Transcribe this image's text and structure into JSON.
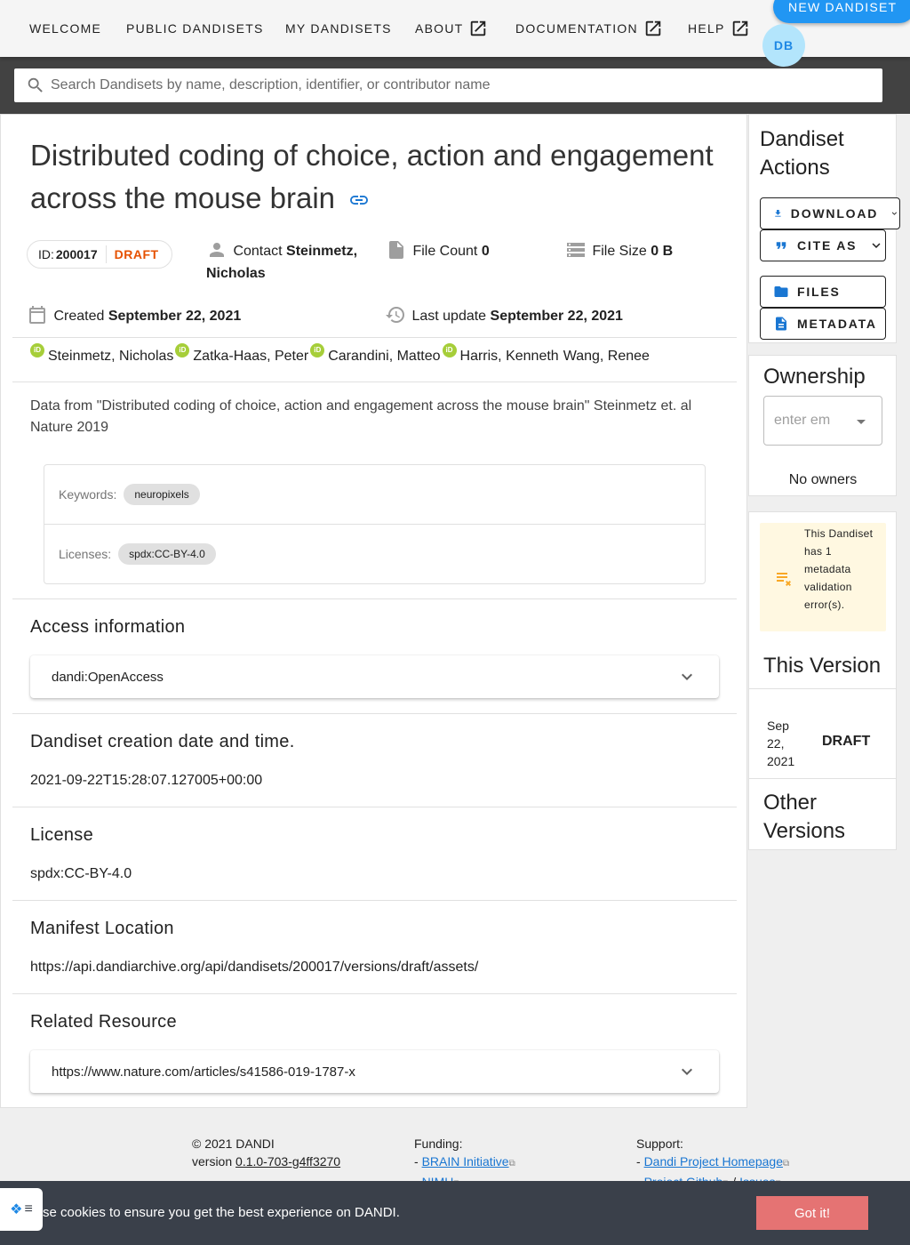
{
  "nav": {
    "welcome": "WELCOME",
    "public_dandisets": "PUBLIC DANDISETS",
    "my_dandisets": "MY DANDISETS",
    "about": "ABOUT",
    "documentation": "DOCUMENTATION",
    "help": "HELP",
    "new_dandiset": "NEW DANDISET",
    "avatar_initials": "DB"
  },
  "search": {
    "placeholder": "Search Dandisets by name, description, identifier, or contributor name"
  },
  "dandiset": {
    "title": "Distributed coding of choice, action and engagement across the mouse brain",
    "id_label": "ID:",
    "id": "200017",
    "status": "DRAFT",
    "contact_label": "Contact",
    "contact_name": "Steinmetz, Nicholas",
    "file_count_label": "File Count",
    "file_count": "0",
    "file_size_label": "File Size",
    "file_size": "0 B",
    "created_label": "Created",
    "created": "September 22, 2021",
    "updated_label": "Last update",
    "updated": "September 22, 2021",
    "contributors": [
      {
        "name": "Steinmetz, Nicholas",
        "orcid": true
      },
      {
        "name": "Zatka-Haas, Peter",
        "orcid": true
      },
      {
        "name": "Carandini, Matteo",
        "orcid": true
      },
      {
        "name": "Harris, Kenneth",
        "orcid": true
      },
      {
        "name": "Wang, Renee",
        "orcid": false
      }
    ],
    "description": "Data from \"Distributed coding of choice, action and engagement across the mouse brain\" Steinmetz et. al Nature 2019",
    "keywords_label": "Keywords:",
    "keywords": [
      "neuropixels"
    ],
    "licenses_label": "Licenses:",
    "licenses": [
      "spdx:CC-BY-4.0"
    ]
  },
  "sections": {
    "access_title": "Access information",
    "access_value": "dandi:OpenAccess",
    "creation_title": "Dandiset creation date and time.",
    "creation_value": "2021-09-22T15:28:07.127005+00:00",
    "license_title": "License",
    "license_value": "spdx:CC-BY-4.0",
    "manifest_title": "Manifest Location",
    "manifest_value": "https://api.dandiarchive.org/api/dandisets/200017/versions/draft/assets/",
    "related_title": "Related Resource",
    "related_value": "https://www.nature.com/articles/s41586-019-1787-x"
  },
  "actions": {
    "title_line1": "Dandiset",
    "title_line2": "Actions",
    "download": "DOWNLOAD",
    "cite_as": "CITE AS",
    "files": "FILES",
    "metadata": "METADATA"
  },
  "ownership": {
    "title": "Ownership",
    "select_placeholder": "enter em",
    "no_owners": "No owners"
  },
  "versions": {
    "warning": "This Dandiset has 1 metadata validation error(s).",
    "this_version_title": "This Version",
    "version_date": "Sep 22, 2021",
    "version_name": "DRAFT",
    "other_title_line1": "Other",
    "other_title_line2": "Versions"
  },
  "footer": {
    "copyright": "© 2021 DANDI",
    "version_label": "version",
    "version": "0.1.0-703-g4ff3270",
    "funding_label": "Funding:",
    "funding": [
      "BRAIN Initiative",
      "NIMH"
    ],
    "support_label": "Support:",
    "support_homepage": "Dandi Project Homepage",
    "support_github": "Project Github",
    "support_issues": "Issues"
  },
  "cookie": {
    "message": "se cookies to ensure you get the best experience on DANDI.",
    "button": "Got it!"
  },
  "colors": {
    "primary": "#2196f3",
    "draft": "#e65100",
    "orcid": "#a6ce39",
    "cookie_bar": "#3a404a",
    "cookie_button": "#e57373",
    "warning_bg": "#fff8e1"
  }
}
